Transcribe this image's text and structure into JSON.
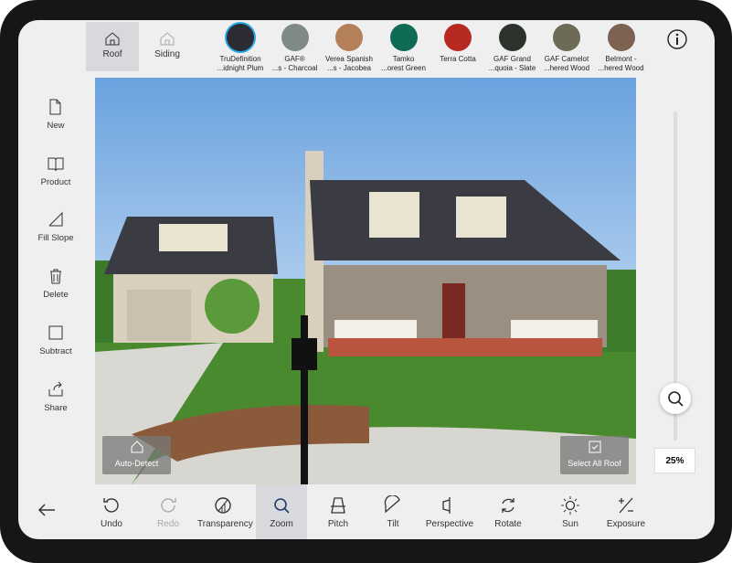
{
  "tabs": [
    {
      "label": "Roof",
      "active": true,
      "icon": "house-icon"
    },
    {
      "label": "Siding",
      "active": false,
      "icon": "house-siding-icon"
    }
  ],
  "swatches": [
    {
      "line1": "TruDefinition",
      "line2": "...idnight Plum",
      "color": "#2b2c33",
      "selected": true
    },
    {
      "line1": "GAF®",
      "line2": "...s - Charcoal",
      "color": "#7f8a86"
    },
    {
      "line1": "Verea Spanish",
      "line2": "...s - Jacobea",
      "color": "#b4805a"
    },
    {
      "line1": "Tamko",
      "line2": "...orest Green",
      "color": "#0f6b55"
    },
    {
      "line1": "Terra Cotta",
      "line2": "",
      "color": "#b62a22"
    },
    {
      "line1": "GAF Grand",
      "line2": "...quoia - Slate",
      "color": "#2c332c"
    },
    {
      "line1": "GAF Camelot",
      "line2": "...hered Wood",
      "color": "#6d6a58"
    },
    {
      "line1": "Belmont -",
      "line2": "...hered Wood",
      "color": "#7c6250"
    }
  ],
  "sidebar": [
    {
      "label": "New",
      "icon": "document-icon"
    },
    {
      "label": "Product",
      "icon": "book-icon"
    },
    {
      "label": "Fill Slope",
      "icon": "slope-icon"
    },
    {
      "label": "Delete",
      "icon": "trash-icon"
    },
    {
      "label": "Subtract",
      "icon": "square-icon"
    },
    {
      "label": "Share",
      "icon": "share-icon"
    }
  ],
  "overlay": {
    "auto_detect": "Auto-Detect",
    "select_all": "Select All Roof"
  },
  "tools": [
    {
      "label": "Undo"
    },
    {
      "label": "Redo",
      "disabled": true
    },
    {
      "label": "Transparency"
    },
    {
      "label": "Zoom",
      "active": true
    },
    {
      "label": "Pitch"
    },
    {
      "label": "Tilt"
    },
    {
      "label": "Perspective"
    },
    {
      "label": "Rotate"
    },
    {
      "label": "Sun"
    },
    {
      "label": "Exposure"
    }
  ],
  "zoom": {
    "value": "25%",
    "level": 25
  }
}
